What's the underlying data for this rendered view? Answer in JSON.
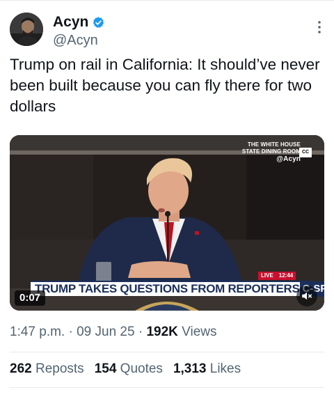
{
  "author": {
    "display_name": "Acyn",
    "handle": "@Acyn",
    "verified": true,
    "verified_color": "#1d9bf0"
  },
  "tweet": {
    "text": "Trump on rail in California: It should’ve never been built because you can fly there for two dollars"
  },
  "video": {
    "overlay_line_1": "THE WHITE HOUSE",
    "overlay_line_2": "STATE DINING ROOM",
    "overlay_handle": "@Acyn",
    "cc_label": "CC",
    "live_label": "LIVE",
    "live_time": "12:44",
    "chyron": "TRUMP TAKES QUESTIONS FROM REPORTERS",
    "network": "C-SPAN",
    "duration": "0:07",
    "mute_icon": "speaker-muted-icon"
  },
  "meta": {
    "time": "1:47 p.m.",
    "date": "09 Jun 25",
    "views_count": "192K",
    "views_label": "Views"
  },
  "stats": {
    "reposts_count": "262",
    "reposts_label": "Reposts",
    "quotes_count": "154",
    "quotes_label": "Quotes",
    "likes_count": "1,313",
    "likes_label": "Likes"
  },
  "colors": {
    "text_primary": "#0f1419",
    "text_secondary": "#536471",
    "divider": "#e7e9ea",
    "chyron_navy": "#1b2f5a",
    "live_red": "#c8102e"
  }
}
